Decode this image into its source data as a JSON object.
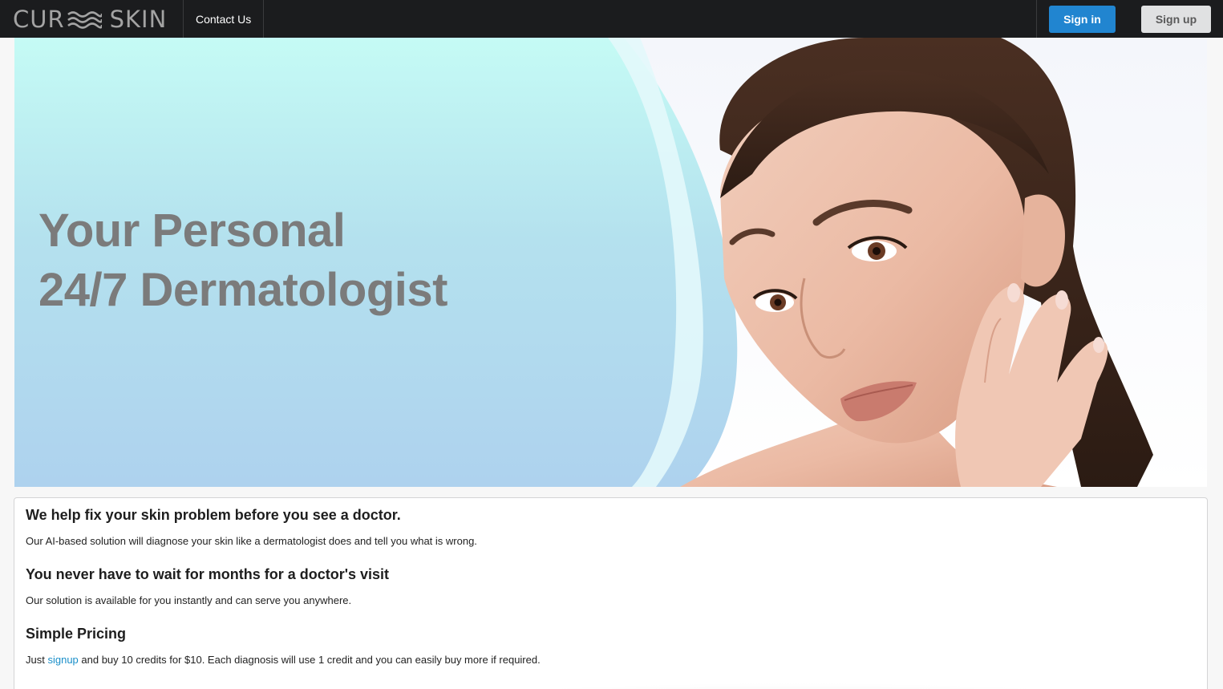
{
  "navbar": {
    "brand": {
      "left": "CUR",
      "right": "SKIN",
      "logo_icon": "waves-icon"
    },
    "contact_label": "Contact Us",
    "signin_label": "Sign in",
    "signup_label": "Sign up"
  },
  "hero": {
    "title_line1": "Your Personal",
    "title_line2": "24/7 Dermatologist"
  },
  "content": {
    "section1_title": "We help fix your skin problem before you see a doctor.",
    "section1_text": "Our AI-based solution will diagnose your skin like a dermatologist does and tell you what is wrong.",
    "section2_title": "You never have to wait for months for a doctor's visit",
    "section2_text": "Our solution is available for you instantly and can serve you anywhere.",
    "section3_title": "Simple Pricing",
    "section3_prefix": "Just ",
    "section3_link": "signup",
    "section3_suffix": " and buy 10 credits for $10. Each diagnosis will use 1 credit and you can easily buy more if required."
  },
  "colors": {
    "navbar_bg": "#1b1c1e",
    "primary_button": "#2185d0",
    "secondary_button": "#e0e1e2",
    "link": "#1a8fc9",
    "hero_title": "#7b7b7b"
  }
}
